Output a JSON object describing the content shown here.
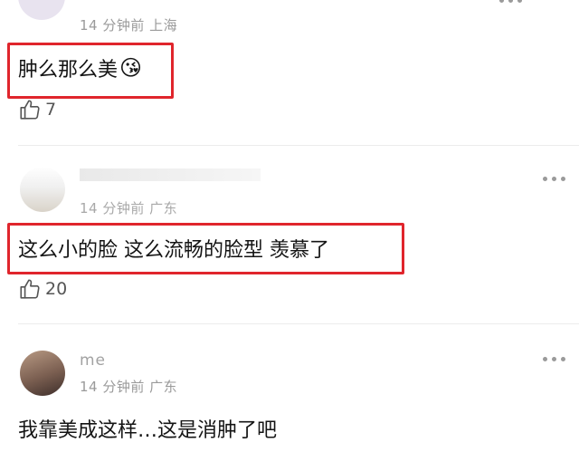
{
  "comments": [
    {
      "meta": "14 分钟前 上海",
      "text": "肿么那么美",
      "emoji": "😘",
      "likes": "7"
    },
    {
      "meta": "14 分钟前 广东",
      "text": "这么小的脸 这么流畅的脸型 羡慕了",
      "likes": "20"
    },
    {
      "username": "me",
      "meta": "14 分钟前 广东",
      "text": "我靠美成这样…这是消肿了吧"
    }
  ],
  "icons": {
    "like": "thumbs-up-icon",
    "more": "more-dots-icon",
    "kiss_emoji": "face-blowing-kiss-emoji"
  }
}
